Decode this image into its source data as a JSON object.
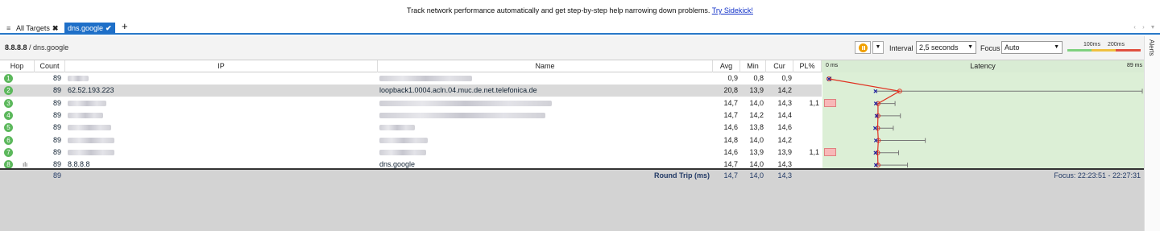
{
  "banner": {
    "text": "Track network performance automatically and get step-by-step help narrowing down problems.",
    "link": "Try Sidekick!"
  },
  "tabs": {
    "all_targets": "All Targets",
    "active": "dns.google"
  },
  "breadcrumb": {
    "target": "8.8.8.8",
    "separator": " / ",
    "host": "dns.google"
  },
  "toolbar": {
    "interval_label": "Interval",
    "interval_value": "2,5 seconds",
    "focus_label": "Focus",
    "focus_value": "Auto",
    "scale_100": "100ms",
    "scale_200": "200ms",
    "scale_colors": [
      "#7fd17f",
      "#f0c040",
      "#e05040"
    ]
  },
  "alerts_label": "Alerts",
  "columns": {
    "hop": "Hop",
    "count": "Count",
    "ip": "IP",
    "name": "Name",
    "avg": "Avg",
    "min": "Min",
    "cur": "Cur",
    "pl": "PL%",
    "latency": "Latency",
    "lat_min": "0 ms",
    "lat_max": "89 ms"
  },
  "rows": [
    {
      "hop": "1",
      "count": "89",
      "ip": "",
      "name": "",
      "avg": "0,9",
      "min": "0,8",
      "cur": "0,9",
      "pl": "",
      "ip_blur": 26,
      "name_blur": 115,
      "lat": 0.9,
      "lo": 0.8,
      "hi": 1.5
    },
    {
      "hop": "2",
      "count": "89",
      "ip": "62.52.193.223",
      "name": "loopback1.0004.acln.04.muc.de.net.telefonica.de",
      "avg": "20,8",
      "min": "13,9",
      "cur": "14,2",
      "pl": "",
      "ip_blur": 0,
      "name_blur": 0,
      "lat": 20.8,
      "lo": 13.9,
      "hi": 89
    },
    {
      "hop": "3",
      "count": "89",
      "ip": "",
      "name": "",
      "avg": "14,7",
      "min": "14,0",
      "cur": "14,3",
      "pl": "1,1",
      "ip_blur": 48,
      "name_blur": 214,
      "lat": 14.7,
      "lo": 14.0,
      "hi": 19.5
    },
    {
      "hop": "4",
      "count": "89",
      "ip": "",
      "name": "",
      "avg": "14,7",
      "min": "14,2",
      "cur": "14,4",
      "pl": "",
      "ip_blur": 44,
      "name_blur": 206,
      "lat": 14.7,
      "lo": 14.2,
      "hi": 21
    },
    {
      "hop": "5",
      "count": "89",
      "ip": "",
      "name": "",
      "avg": "14,6",
      "min": "13,8",
      "cur": "14,6",
      "pl": "",
      "ip_blur": 54,
      "name_blur": 44,
      "lat": 14.6,
      "lo": 13.8,
      "hi": 19
    },
    {
      "hop": "6",
      "count": "89",
      "ip": "",
      "name": "",
      "avg": "14,8",
      "min": "14,0",
      "cur": "14,2",
      "pl": "",
      "ip_blur": 58,
      "name_blur": 60,
      "lat": 14.8,
      "lo": 14.0,
      "hi": 28
    },
    {
      "hop": "7",
      "count": "89",
      "ip": "",
      "name": "",
      "avg": "14,6",
      "min": "13,9",
      "cur": "13,9",
      "pl": "1,1",
      "ip_blur": 58,
      "name_blur": 58,
      "lat": 14.6,
      "lo": 13.9,
      "hi": 20.5
    },
    {
      "hop": "8",
      "count": "89",
      "ip": "8.8.8.8",
      "name": "dns.google",
      "avg": "14,7",
      "min": "14,0",
      "cur": "14,3",
      "pl": "",
      "ip_blur": 0,
      "name_blur": 0,
      "lat": 14.7,
      "lo": 14.0,
      "hi": 23
    }
  ],
  "latency_max_ms": 89,
  "footer": {
    "count": "89",
    "label": "Round Trip (ms)",
    "avg": "14,7",
    "min": "14,0",
    "cur": "14,3",
    "focus": "Focus: 22:23:51 - 22:27:31"
  }
}
